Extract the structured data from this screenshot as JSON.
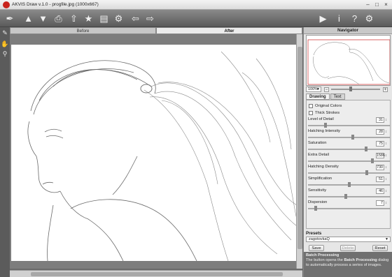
{
  "window": {
    "title": "AKVIS Draw v.1.0 - progfile.jpg (1000x667)"
  },
  "toolbar": {
    "icons": [
      "open-icon",
      "save-icon",
      "print-icon",
      "upload-icon",
      "share-icon",
      "batch-icon",
      "settings-icon",
      "undo-icon",
      "redo-icon",
      "run-icon",
      "info-icon",
      "help-icon",
      "preferences-icon"
    ]
  },
  "tabs": {
    "before": "Before",
    "after": "After"
  },
  "navigator": {
    "title": "Navigator",
    "zoom": "100%",
    "zoom_minus": "−",
    "zoom_plus": "+",
    "zoom_level": 0.4
  },
  "panel_tabs": {
    "drawing": "Drawing",
    "text": "Text"
  },
  "params": {
    "original_colors": "Original Colors",
    "thick_strokes": "Thick Strokes",
    "sliders": [
      {
        "label": "Level of Detail",
        "value": "31",
        "level": 0.2
      },
      {
        "label": "Hatching Intensity",
        "value": "28",
        "level": 0.55
      },
      {
        "label": "Saturation",
        "value": "75",
        "level": 0.72
      },
      {
        "label": "Extra Detail",
        "value": "1586",
        "level": 0.8
      },
      {
        "label": "Hatching Density",
        "value": "730",
        "level": 0.73
      },
      {
        "label": "Simplification",
        "value": "51",
        "level": 0.5
      },
      {
        "label": "Sensitivity",
        "value": "46",
        "level": 0.46
      },
      {
        "label": "Dispersion",
        "value": "7",
        "level": 0.08
      }
    ]
  },
  "presets": {
    "title": "Presets",
    "selected": "zagotovkaQ",
    "save": "Save",
    "delete": "Delete",
    "reset": "Reset"
  },
  "help": {
    "title": "Batch Processing",
    "text_before": "The button opens the ",
    "text_bold": "Batch Processing",
    "text_after": " dialog to automatically process a series of images."
  }
}
